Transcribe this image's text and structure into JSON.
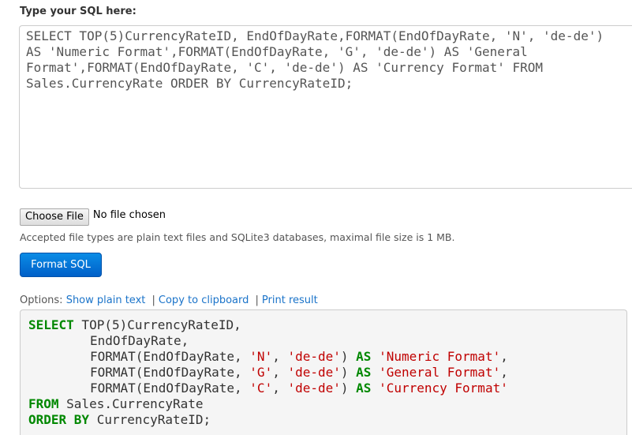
{
  "input": {
    "label": "Type your SQL here:",
    "sql": "SELECT TOP(5)CurrencyRateID, EndOfDayRate,FORMAT(EndOfDayRate, 'N', 'de-de') AS 'Numeric Format',FORMAT(EndOfDayRate, 'G', 'de-de') AS 'General Format',FORMAT(EndOfDayRate, 'C', 'de-de') AS 'Currency Format' FROM Sales.CurrencyRate ORDER BY CurrencyRateID;"
  },
  "file": {
    "button_label": "Choose File",
    "status": "No file chosen",
    "accepted_note": "Accepted file types are plain text files and SQLite3 databases, maximal file size is 1 MB."
  },
  "format_button": {
    "label": "Format SQL",
    "color": "#0a7fd9"
  },
  "options": {
    "label": "Options:",
    "links": [
      "Show plain text",
      "Copy to clipboard",
      "Print result"
    ],
    "separator": "|"
  },
  "result": {
    "l1_kw": "SELECT",
    "l1_text": " TOP(5)CurrencyRateID,",
    "l2_text": "EndOfDayRate,",
    "l3_fn": "FORMAT(EndOfDayRate, ",
    "l3_s1": "'N'",
    "l3_c1": ", ",
    "l3_s2": "'de-de'",
    "l3_c2": ") ",
    "l3_kw": "AS",
    "l3_sp": " ",
    "l3_s3": "'Numeric Format'",
    "l3_end": ",",
    "l4_fn": "FORMAT(EndOfDayRate, ",
    "l4_s1": "'G'",
    "l4_c1": ", ",
    "l4_s2": "'de-de'",
    "l4_c2": ") ",
    "l4_kw": "AS",
    "l4_sp": " ",
    "l4_s3": "'General Format'",
    "l4_end": ",",
    "l5_fn": "FORMAT(EndOfDayRate, ",
    "l5_s1": "'C'",
    "l5_c1": ", ",
    "l5_s2": "'de-de'",
    "l5_c2": ") ",
    "l5_kw": "AS",
    "l5_sp": " ",
    "l5_s3": "'Currency Format'",
    "l6_kw": "FROM",
    "l6_text": " Sales.CurrencyRate",
    "l7_kw": "ORDER BY",
    "l7_text": " CurrencyRateID;",
    "keyword_color": "#008800",
    "string_color": "#c00000"
  }
}
